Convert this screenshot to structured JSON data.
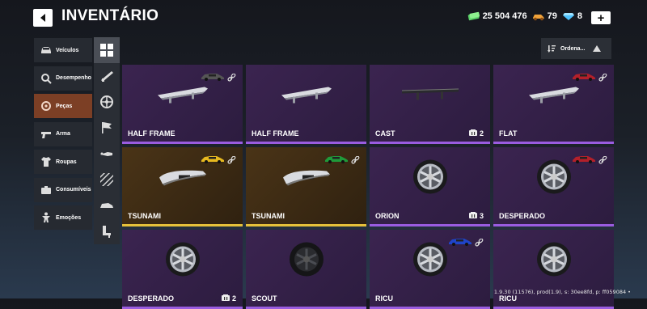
{
  "header": {
    "title": "INVENTÁRIO",
    "back_icon": "back-arrow-icon",
    "plus_label": "+"
  },
  "currencies": [
    {
      "icon": "cash-icon",
      "color": "#5dd36a",
      "value": "25 504 476"
    },
    {
      "icon": "gold-car-icon",
      "color": "#f0a23a",
      "value": "79"
    },
    {
      "icon": "diamond-icon",
      "color": "#4fc3ff",
      "value": "8"
    }
  ],
  "menu": [
    {
      "label": "Veículos",
      "icon": "car-icon",
      "active": false
    },
    {
      "label": "Desempenho",
      "icon": "performance-icon",
      "active": false
    },
    {
      "label": "Peças",
      "icon": "parts-icon",
      "active": true
    },
    {
      "label": "Arma",
      "icon": "gun-icon",
      "active": false
    },
    {
      "label": "Roupas",
      "icon": "shirt-icon",
      "active": false
    },
    {
      "label": "Consumíveis",
      "icon": "consumables-icon",
      "active": false
    },
    {
      "label": "Emoções",
      "icon": "emote-icon",
      "active": false
    }
  ],
  "subtabs": [
    "grid-icon",
    "spoiler-icon",
    "wheel-icon",
    "flag-icon",
    "exhaust-icon",
    "stripes-icon",
    "body-kit-icon",
    "seat-icon"
  ],
  "sort": {
    "label": "Ordena...",
    "icon": "sort-icon"
  },
  "items": [
    {
      "name": "HALF FRAME",
      "kind": "spoiler",
      "rarity": "epic",
      "car_color": "#555",
      "linked": true,
      "qty": ""
    },
    {
      "name": "HALF FRAME",
      "kind": "spoiler",
      "rarity": "epic",
      "car_color": "",
      "linked": false,
      "qty": ""
    },
    {
      "name": "CAST",
      "kind": "spoiler-dark",
      "rarity": "epic",
      "car_color": "",
      "linked": false,
      "qty": "2"
    },
    {
      "name": "FLAT",
      "kind": "spoiler",
      "rarity": "epic",
      "car_color": "#b3202a",
      "linked": true,
      "qty": ""
    },
    {
      "name": "TSUNAMI",
      "kind": "mirror",
      "rarity": "legendary",
      "car_color": "#e7b91f",
      "linked": true,
      "qty": ""
    },
    {
      "name": "TSUNAMI",
      "kind": "mirror",
      "rarity": "legendary",
      "car_color": "#1f9a3a",
      "linked": true,
      "qty": ""
    },
    {
      "name": "ORION",
      "kind": "wheel",
      "rarity": "epic",
      "car_color": "",
      "linked": false,
      "qty": "3"
    },
    {
      "name": "DESPERADO",
      "kind": "wheel",
      "rarity": "epic",
      "car_color": "#b3202a",
      "linked": true,
      "qty": ""
    },
    {
      "name": "DESPERADO",
      "kind": "wheel",
      "rarity": "epic",
      "car_color": "",
      "linked": false,
      "qty": "2"
    },
    {
      "name": "SCOUT",
      "kind": "wheel-dark",
      "rarity": "epic",
      "car_color": "",
      "linked": false,
      "qty": ""
    },
    {
      "name": "RICU",
      "kind": "wheel",
      "rarity": "epic",
      "car_color": "#1f44c9",
      "linked": true,
      "qty": ""
    },
    {
      "name": "RICU",
      "kind": "wheel",
      "rarity": "epic",
      "car_color": "",
      "linked": false,
      "qty": ""
    }
  ],
  "build_info": "1.9.30 (11576), prod(1.9), s: 30ee8fd, p: ff059084 •"
}
